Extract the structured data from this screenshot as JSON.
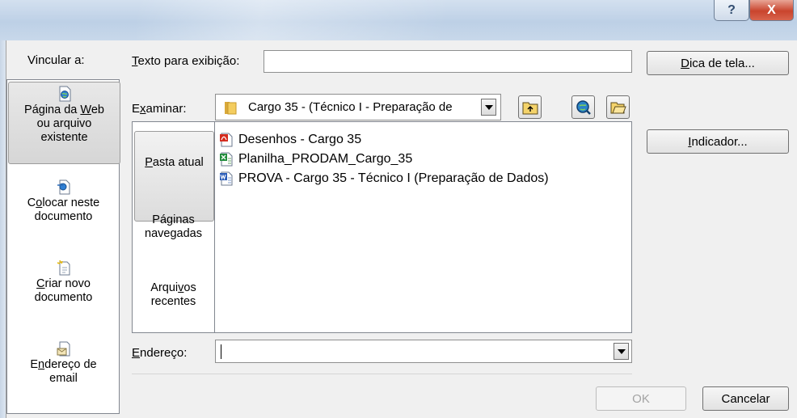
{
  "window": {
    "help_glyph": "?",
    "close_glyph": "X"
  },
  "link_to": {
    "label": "Vincular a:",
    "items": [
      {
        "label_pre": "Página da ",
        "label_key": "W",
        "label_post": "eb",
        "label_line2": "ou arquivo existente",
        "icon": "web-page-icon",
        "selected": true
      },
      {
        "label_pre": "C",
        "label_key": "o",
        "label_post": "locar neste",
        "label_line2": "documento",
        "icon": "place-in-document-icon",
        "selected": false
      },
      {
        "label_pre": "",
        "label_key": "C",
        "label_post": "riar novo",
        "label_line2": "documento",
        "icon": "new-document-icon",
        "selected": false
      },
      {
        "label_pre": "E",
        "label_key": "n",
        "label_post": "dereço de",
        "label_line2": "email",
        "icon": "email-icon",
        "selected": false
      }
    ]
  },
  "display_text": {
    "label_key": "T",
    "label_rest": "exto para exibição:",
    "value": ""
  },
  "screen_tip_button": {
    "label_key": "D",
    "label_rest": "ica de tela..."
  },
  "bookmark_button": {
    "label_key": "I",
    "label_rest": "ndicador..."
  },
  "look_in": {
    "label_pre": "E",
    "label_key": "x",
    "label_post": "aminar:",
    "value": "Cargo 35 - (Técnico I - Preparação de"
  },
  "tabs": [
    {
      "line1_key": "P",
      "line1_rest": "asta atual",
      "line2": "",
      "selected": true
    },
    {
      "line1_pre": "Pá",
      "line1_key": "g",
      "line1_rest": "inas",
      "line2": "navegadas",
      "selected": false
    },
    {
      "line1_pre": "Arqui",
      "line1_key": "v",
      "line1_rest": "os",
      "line2": "recentes",
      "selected": false
    }
  ],
  "files": [
    {
      "name": "Desenhos - Cargo 35",
      "icon": "pdf-file-icon"
    },
    {
      "name": "Planilha_PRODAM_Cargo_35",
      "icon": "excel-file-icon"
    },
    {
      "name": "PROVA - Cargo 35 - Técnico I (Preparação de Dados)",
      "icon": "word-file-icon"
    }
  ],
  "address": {
    "label_key": "E",
    "label_rest": "ndereço:",
    "value": ""
  },
  "ok_button": "OK",
  "cancel_button": "Cancelar",
  "colors": {
    "selected_item": "#d9d9d9",
    "title_bar": "#c8d8ea",
    "close_button": "#c9442d"
  }
}
